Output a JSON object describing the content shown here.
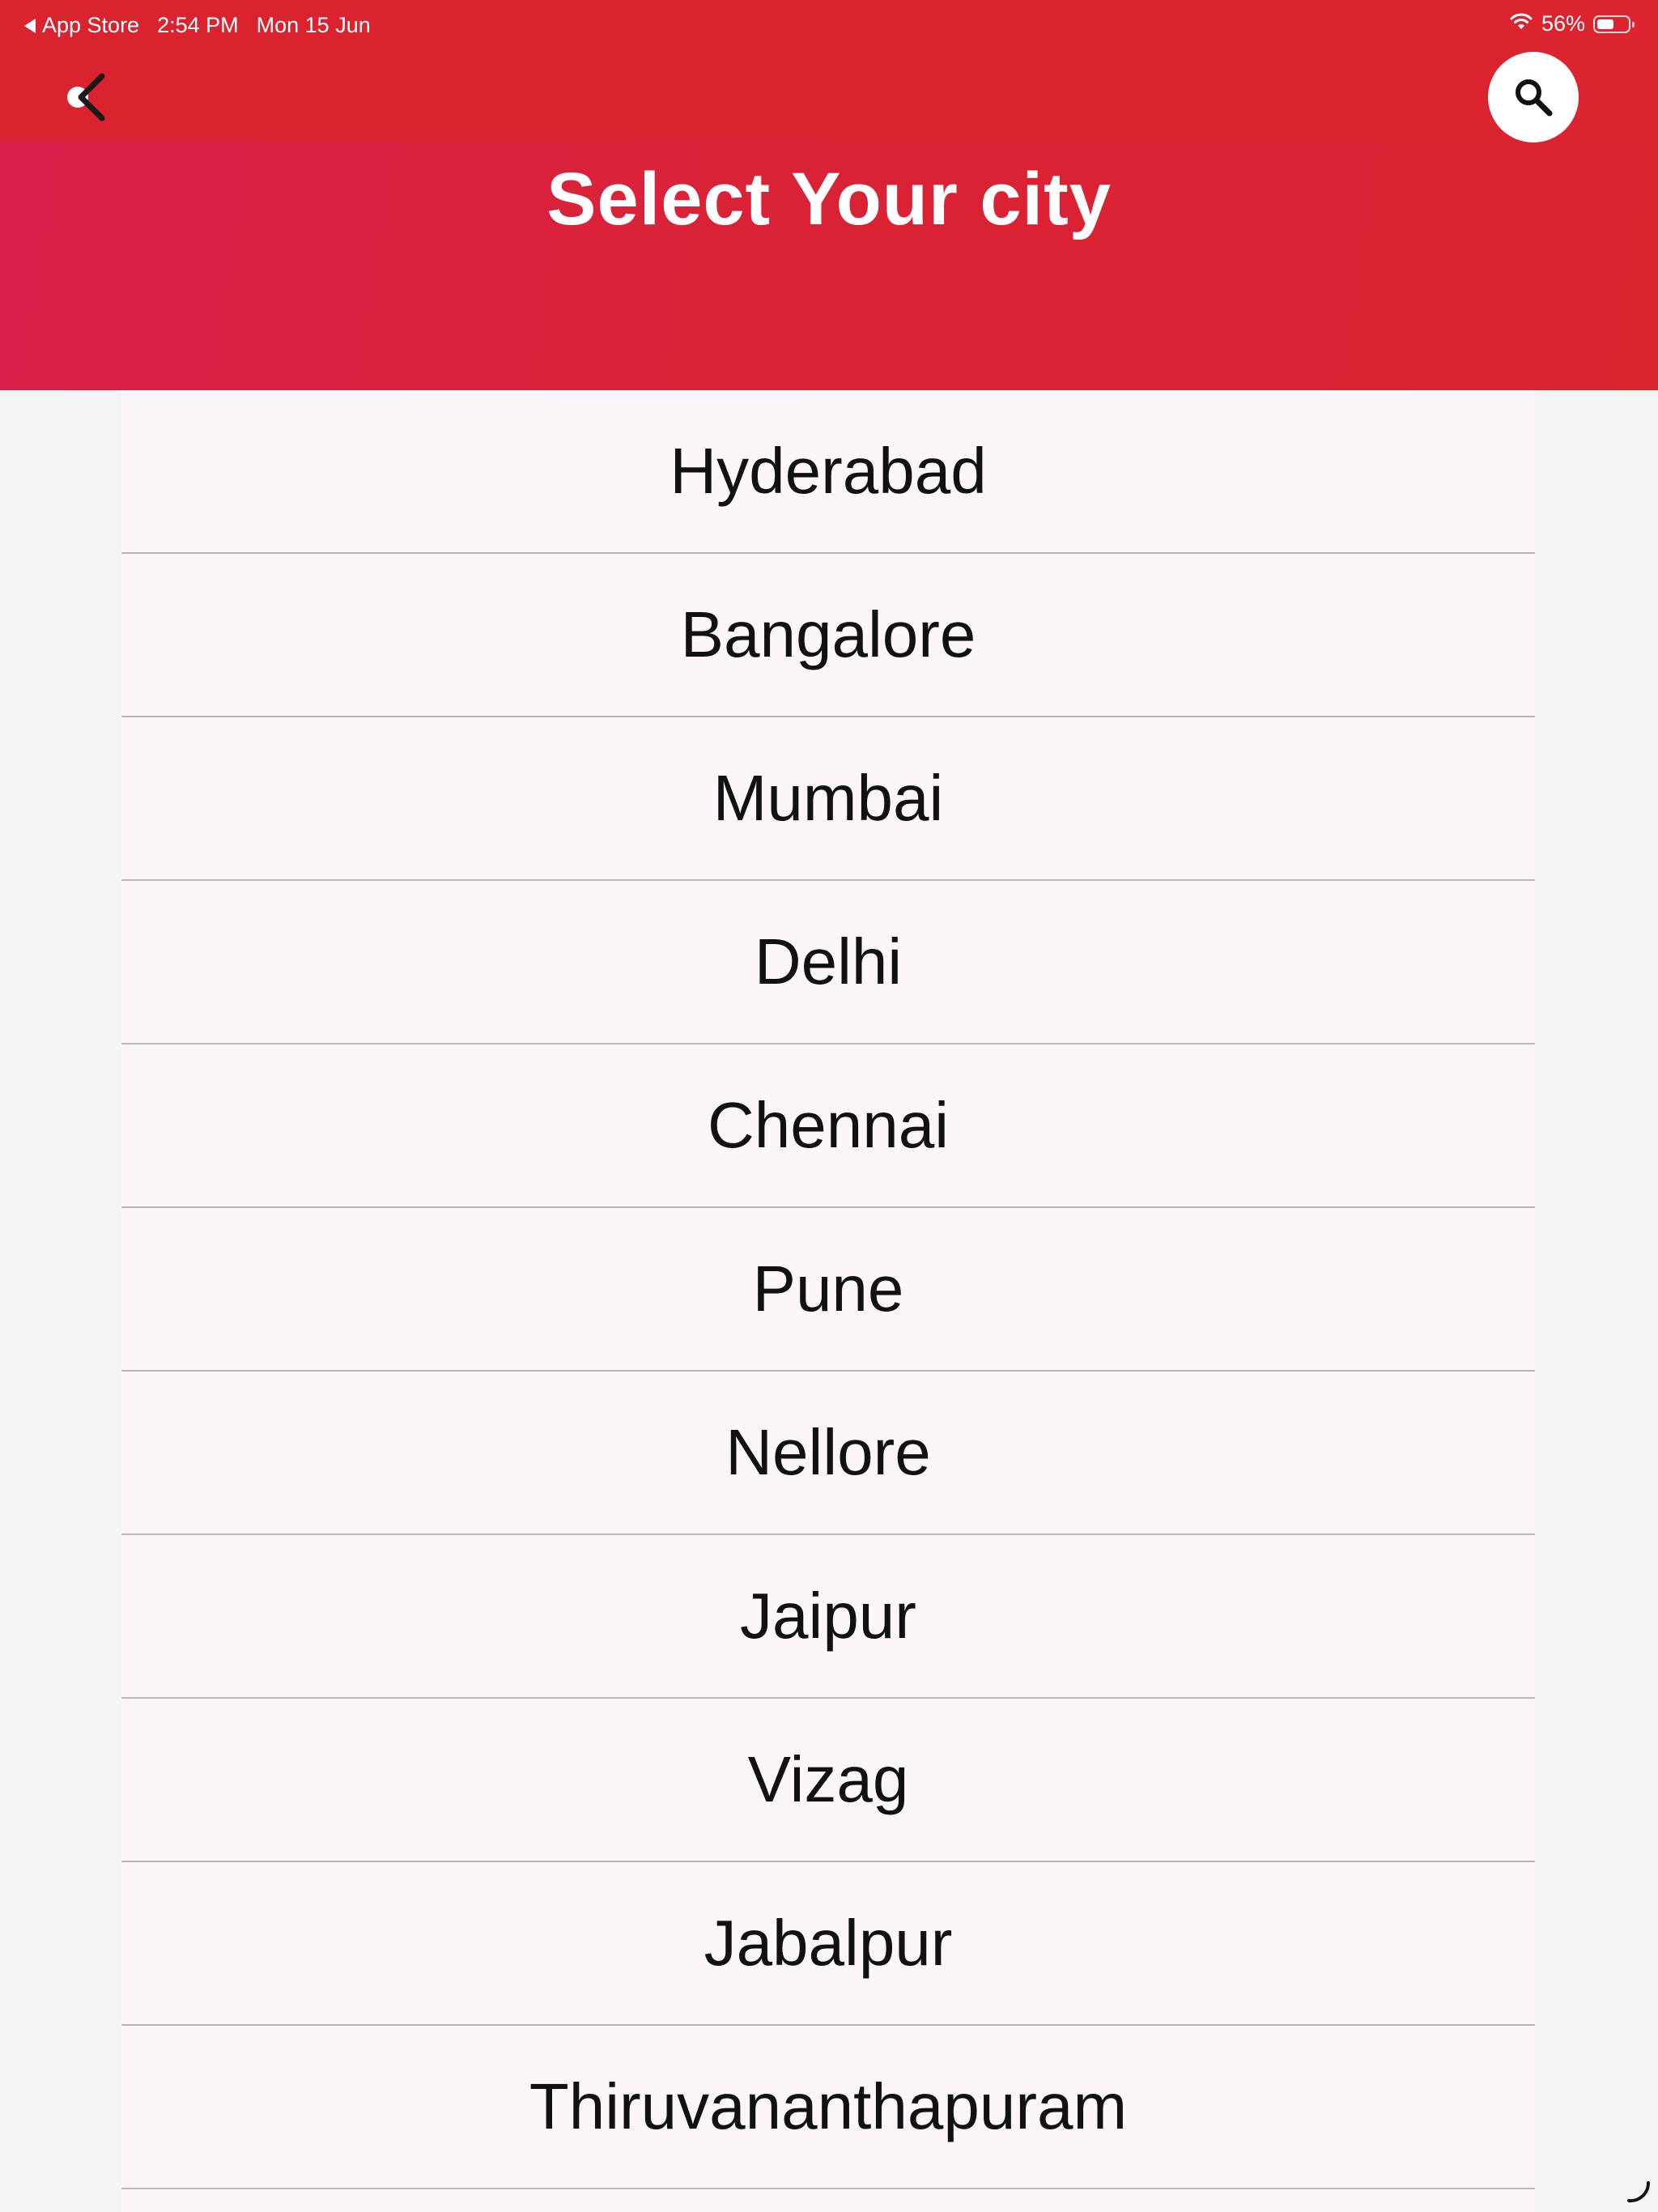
{
  "status_bar": {
    "back_app": "App Store",
    "time": "2:54 PM",
    "date": "Mon 15 Jun",
    "battery_percent": "56%",
    "battery_level": 0.56
  },
  "header": {
    "title": "Select Your city",
    "back_icon": "chevron-left-icon",
    "search_icon": "search-icon"
  },
  "cities": [
    "Hyderabad",
    "Bangalore",
    "Mumbai",
    "Delhi",
    "Chennai",
    "Pune",
    "Nellore",
    "Jaipur",
    "Vizag",
    "Jabalpur",
    "Thiruvananthapuram"
  ],
  "colors": {
    "header_red": "#d9232f",
    "header_pink": "#d81f4b",
    "list_background": "#fcf6fb",
    "divider": "#b9b9b9"
  }
}
